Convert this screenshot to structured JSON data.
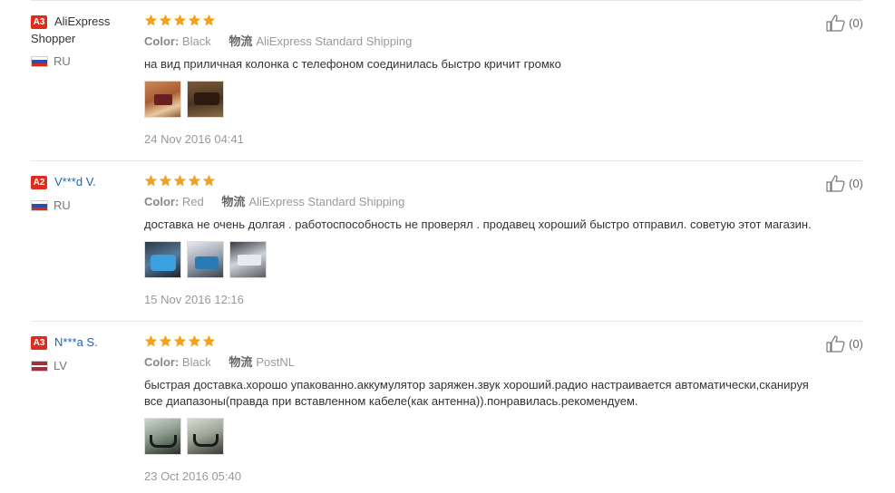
{
  "colors": {
    "badge": "#e02c1d",
    "star": "#f7a11a",
    "link": "#1e64b4"
  },
  "reviews": [
    {
      "level": "A3",
      "name_line1": "AliExpress",
      "name_line2": "Shopper",
      "country": "RU",
      "flag": "russia-flag-icon",
      "stars": 5,
      "color_label": "Color:",
      "color_value": "Black",
      "logistics_label": "物流",
      "logistics_value": "AliExpress Standard Shipping",
      "text": "на вид приличная колонка с телефоном соединилась быстро кричит громко",
      "photos": 2,
      "date": "24 Nov 2016 04:41",
      "helpful": "(0)"
    },
    {
      "level": "A2",
      "name_line1": "V***d V.",
      "country": "RU",
      "flag": "russia-flag-icon",
      "stars": 5,
      "color_label": "Color:",
      "color_value": "Red",
      "logistics_label": "物流",
      "logistics_value": "AliExpress Standard Shipping",
      "text": "доставка не очень долгая . работоспособность не проверял . продавец хороший быстро отправил. советую этот магазин.",
      "photos": 3,
      "date": "15 Nov 2016 12:16",
      "helpful": "(0)"
    },
    {
      "level": "A3",
      "name_line1": "N***a S.",
      "country": "LV",
      "flag": "latvia-flag-icon",
      "stars": 5,
      "color_label": "Color:",
      "color_value": "Black",
      "logistics_label": "物流",
      "logistics_value": "PostNL",
      "text_line1": "быстрая доставка.хорошо упакованно.аккумулятор заряжен.звук хороший.радио настраивается автоматически,сканируя",
      "text_line2": "все диапазоны(правда при вставленном кабеле(как антенна)).понравилась.рекомендуем.",
      "photos": 2,
      "date": "23 Oct 2016 05:40",
      "helpful": "(0)"
    }
  ]
}
